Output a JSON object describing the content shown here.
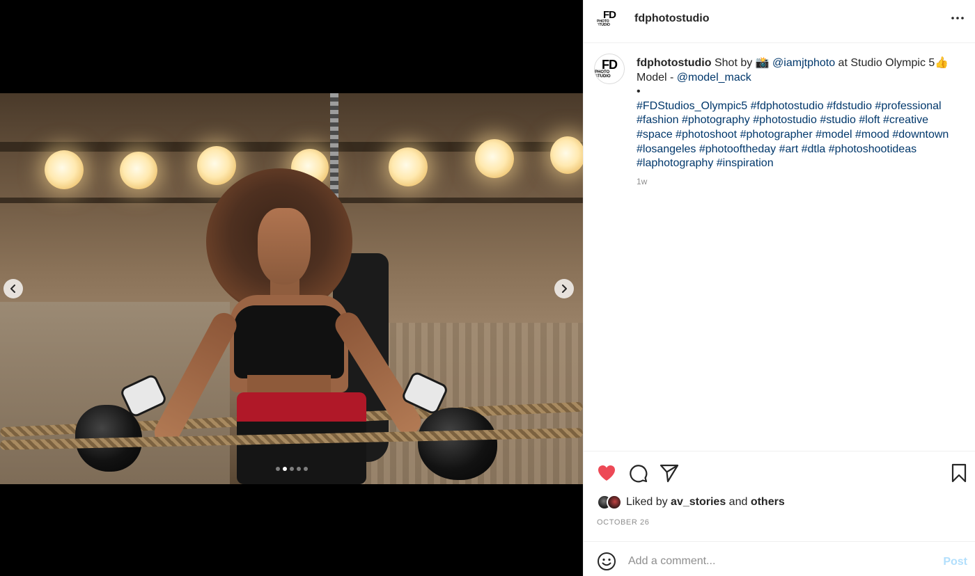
{
  "post": {
    "username": "fdphotostudio",
    "avatar_text": "FD",
    "avatar_subtext": "PHOTO STUDIO"
  },
  "caption": {
    "username": "fdphotostudio",
    "line1_before": "Shot by 📸 ",
    "mention1": "@iamjtphoto",
    "line1_after": " at Studio Olympic 5👍",
    "line2_before": "Model - ",
    "mention2": "@model_mack",
    "line3": "•",
    "hashtags": "#FDStudios_Olympic5 #fdphotostudio #fdstudio #professional #fashion #photography #photostudio #studio #loft #creative #space #photoshoot #photographer #model #mood #downtown #losangeles #photooftheday #art #dtla #photoshootideas #laphotography #inspiration",
    "time": "1w"
  },
  "carousel": {
    "total_slides": 5,
    "active_index": 1,
    "prev_icon": "chevron-left-icon",
    "next_icon": "chevron-right-icon"
  },
  "actions": {
    "like_icon": "heart-icon",
    "liked": true,
    "comment_icon": "comment-icon",
    "share_icon": "paper-plane-icon",
    "save_icon": "bookmark-icon"
  },
  "likes": {
    "prefix": "Liked by ",
    "user": "av_stories",
    "middle": " and ",
    "others": "others"
  },
  "date": "OCTOBER 26",
  "comment": {
    "placeholder": "Add a comment...",
    "post_label": "Post",
    "emoji_icon": "smiley-icon"
  },
  "colors": {
    "like_red": "#ed4956",
    "link_blue": "#00376b",
    "post_disabled": "#b2dffc",
    "muted": "#8e8e8e"
  }
}
